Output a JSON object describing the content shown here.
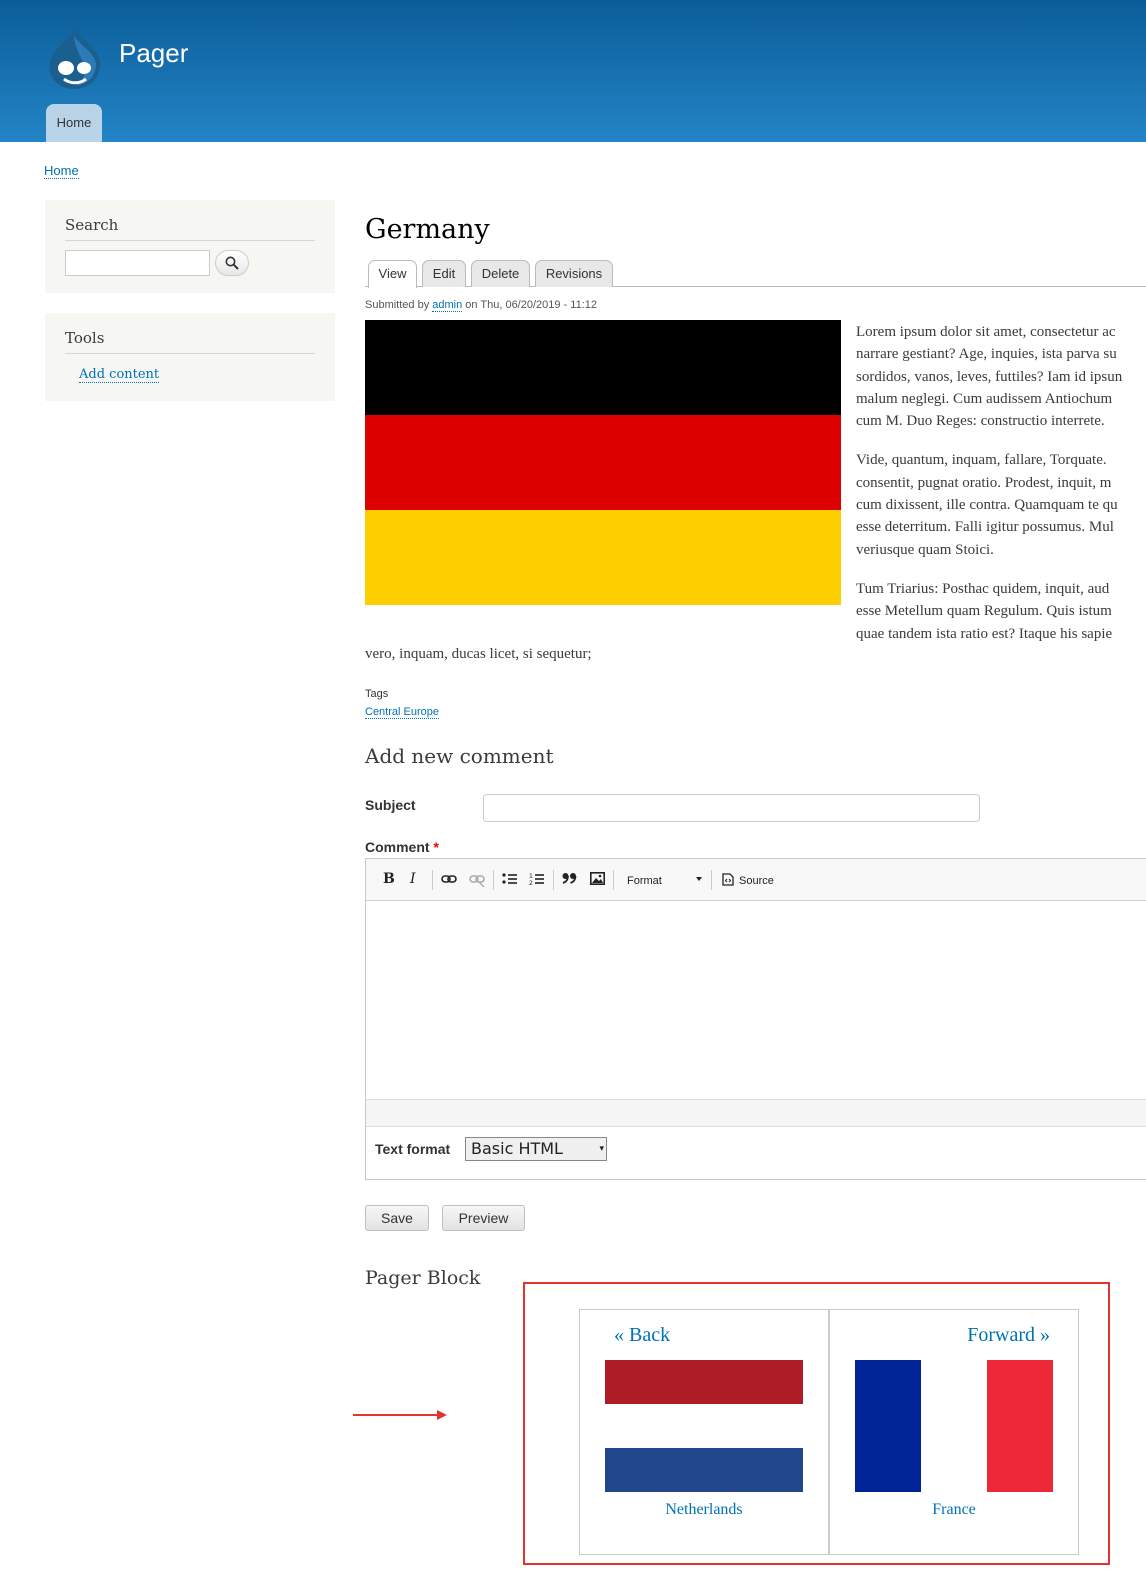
{
  "site": {
    "name": "Pager",
    "nav_home": "Home"
  },
  "breadcrumb": "Home",
  "sidebar": {
    "search_title": "Search",
    "tools_title": "Tools",
    "add_content": "Add content"
  },
  "node": {
    "title": "Germany",
    "tabs": [
      "View",
      "Edit",
      "Delete",
      "Revisions"
    ],
    "submitted_prefix": "Submitted by ",
    "author": "admin",
    "submitted_suffix": " on Thu, 06/20/2019 - 11:12",
    "paragraphs": [
      [
        "Lorem ipsum dolor sit amet, consectetur ac",
        "narrare gestiant? Age, inquies, ista parva su",
        "sordidos, vanos, leves, futtiles? Iam id ipsun",
        "malum neglegi. Cum audissem Antiochum",
        "cum M. Duo Reges: constructio interrete."
      ],
      [
        "Vide, quantum, inquam, fallare, Torquate.",
        "consentit, pugnat oratio. Prodest, inquit, m",
        "cum dixissent, ille contra. Quamquam te qu",
        "esse deterritum. Falli igitur possumus. Mul",
        "veriusque quam Stoici."
      ],
      [
        "Tum Triarius: Posthac quidem, inquit, aud",
        "esse Metellum quam Regulum. Quis istum",
        "quae tandem ista ratio est? Itaque his sapie"
      ]
    ],
    "body_tail": "vero, inquam, ducas licet, si sequetur;",
    "tags_label": "Tags",
    "tag": "Central Europe"
  },
  "comment_form": {
    "title": "Add new comment",
    "subject_label": "Subject",
    "comment_label": "Comment",
    "required_mark": "*",
    "toolbar": {
      "bold": "B",
      "italic": "I",
      "format": "Format",
      "source": "Source"
    },
    "text_format_label": "Text format",
    "text_format_value": "Basic HTML",
    "save": "Save",
    "preview": "Preview"
  },
  "pager": {
    "title": "Pager Block",
    "back": {
      "label": "« Back",
      "caption": "Netherlands"
    },
    "forward": {
      "label": "Forward »",
      "caption": "France"
    }
  },
  "colors": {
    "header_top": "#0a5d98",
    "header_bottom": "#2484c6",
    "flag_de": [
      "#000000",
      "#dd0000",
      "#ffce00"
    ],
    "flag_nl": [
      "#ae1c28",
      "#ffffff",
      "#21468b"
    ],
    "flag_fr": [
      "#002395",
      "#ffffff",
      "#ed2939"
    ],
    "highlight": "#e3342f",
    "link": "#0071b3"
  }
}
